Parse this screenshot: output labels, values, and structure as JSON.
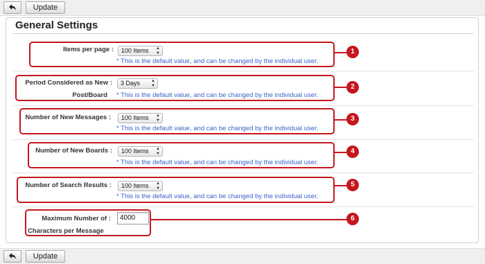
{
  "toolbar": {
    "back_icon": "back-arrow-icon",
    "update_label": "Update"
  },
  "section": {
    "title": "General Settings"
  },
  "default_note": "* This is the default value, and can be changed by the individual user.",
  "settings": {
    "items_per_page": {
      "label": "Items per page",
      "value": "100 Items",
      "badge": "1"
    },
    "period_new": {
      "label_line1": "Period Considered as New",
      "label_line2": "Post/Board",
      "value": "3 Days",
      "badge": "2"
    },
    "new_messages": {
      "label": "Number of New Messages",
      "value": "100 Items",
      "badge": "3"
    },
    "new_boards": {
      "label": "Number of New Boards",
      "value": "100 Items",
      "badge": "4"
    },
    "search_results": {
      "label": "Number of Search Results",
      "value": "100 Items",
      "badge": "5"
    },
    "max_chars": {
      "label_line1": "Maximum Number of",
      "label_line2": "Characters per Message",
      "value": "4000",
      "badge": "6"
    }
  },
  "colors": {
    "highlight": "#c5161d",
    "note": "#3a63c9",
    "toolbar": "#efefef"
  }
}
